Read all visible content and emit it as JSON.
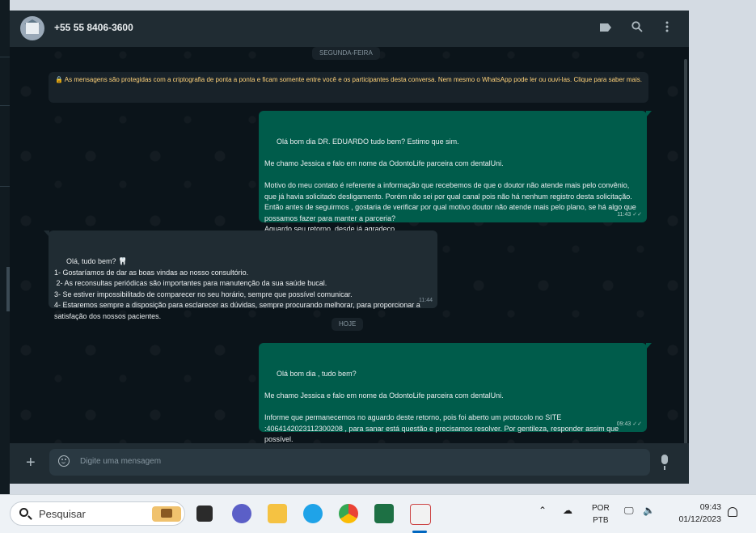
{
  "header": {
    "contact_name": "+55 55 8406-3600",
    "icons": [
      "label-icon",
      "search-icon",
      "menu-dots-icon"
    ]
  },
  "days": {
    "first": "SEGUNDA-FEIRA",
    "second": "HOJE"
  },
  "encryption_notice": "🔒 As mensagens são protegidas com a criptografia de ponta a ponta e ficam somente entre você e os participantes desta conversa. Nem mesmo o WhatsApp pode ler ou ouvi-las. Clique para saber mais.",
  "messages": [
    {
      "direction": "out",
      "text": "Olá bom dia DR. EDUARDO tudo bem? Estimo que sim.\n\nMe chamo Jessica e falo em nome da OdontoLife parceira com dentalUni.\n\nMotivo do meu contato é referente a informação que recebemos de que o doutor não atende mais pelo convênio, que já havia solicitado desligamento. Porém não sei por qual canal pois não há nenhum registro desta solicitação. Então antes de seguirmos , gostaria de verificar por qual motivo doutor não atende mais pelo plano, se há algo que possamos fazer para manter a parceria?\nAguardo seu retorno, desde já agradeço.",
      "time": "11:43",
      "status": "✓✓"
    },
    {
      "direction": "in",
      "text": "Olá, tudo bem? 🦷\n1- Gostaríamos de dar as boas vindas ao nosso consultório.\n 2- As reconsultas periódicas são importantes para manutenção da sua saúde bucal.\n3- Se estiver impossibilitado de comparecer no seu horário, sempre que possível comunicar.\n4- Estaremos sempre a disposição para esclarecer as dúvidas, sempre procurando melhorar, para proporcionar a satisfação dos nossos pacientes.",
      "time": "11:44"
    },
    {
      "direction": "out",
      "text": "Olá bom dia , tudo bem?\n\nMe chamo Jessica e falo em nome da OdontoLife parceira com dentalUni.\n\nInforme que permanecemos no aguardo deste retorno, pois foi aberto um protocolo no SITE :4064142023112300208 , para sanar está questão e precisamos resolver. Por gentileza, responder assim que possível.",
      "time": "09:43",
      "status": "✓✓"
    }
  ],
  "composer": {
    "placeholder": "Digite uma mensagem"
  },
  "taskbar": {
    "search_label": "Pesquisar",
    "language_line1": "POR",
    "language_line2": "PTB",
    "time": "09:43",
    "date": "01/12/2023"
  },
  "colors": {
    "outgoing_bubble": "#005c4b",
    "incoming_bubble": "#202c33",
    "chat_background": "#0b141a",
    "notice_text": "#ffd279"
  }
}
